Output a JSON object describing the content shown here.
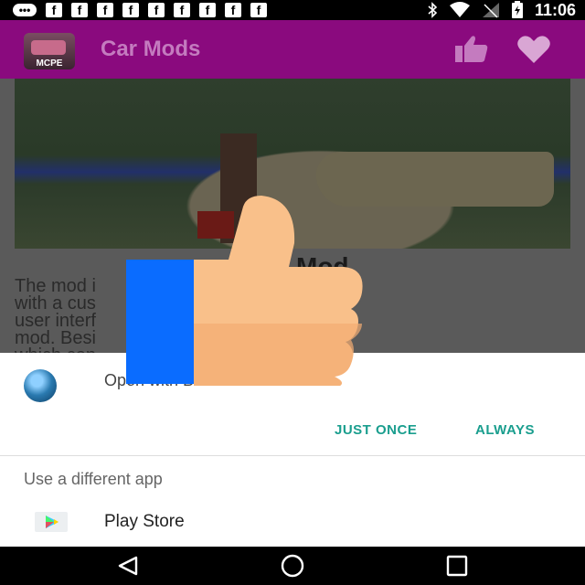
{
  "status_bar": {
    "time": "11:06",
    "notification_icons": [
      "messenger-icon",
      "facebook-icon",
      "facebook-icon",
      "facebook-icon",
      "facebook-icon",
      "facebook-icon",
      "facebook-icon",
      "facebook-icon",
      "facebook-icon",
      "facebook-icon"
    ],
    "fb_glyph": "f",
    "right_icons": [
      "bluetooth-icon",
      "wifi-icon",
      "no-signal-icon",
      "battery-charging-icon"
    ]
  },
  "app_bar": {
    "title": "Car Mods",
    "logo_text": "MCPE",
    "background": "#8a0a7e",
    "title_color": "#c47bbf"
  },
  "article": {
    "title_visible": "Mod",
    "text_lines": [
      "The mod i            ced car system",
      "with a cus               unique graphical",
      "user interf             structured for this",
      "mod. Besi                  t also adds blocks",
      "which con                 o travel on using"
    ]
  },
  "chooser": {
    "open_with_text": "Open with B",
    "just_once_label": "JUST ONCE",
    "always_label": "ALWAYS",
    "accent": "#1a9e8e",
    "different_app_label": "Use a different app",
    "apps": [
      {
        "label": "Play Store",
        "icon": "play-store-icon"
      }
    ]
  },
  "overlay": {
    "icon": "thumbs-up-icon",
    "cuff_color": "#0a6cff",
    "hand_color": "#f9c08a"
  },
  "nav_bar": {
    "buttons": [
      "back-icon",
      "home-icon",
      "recents-icon"
    ]
  }
}
